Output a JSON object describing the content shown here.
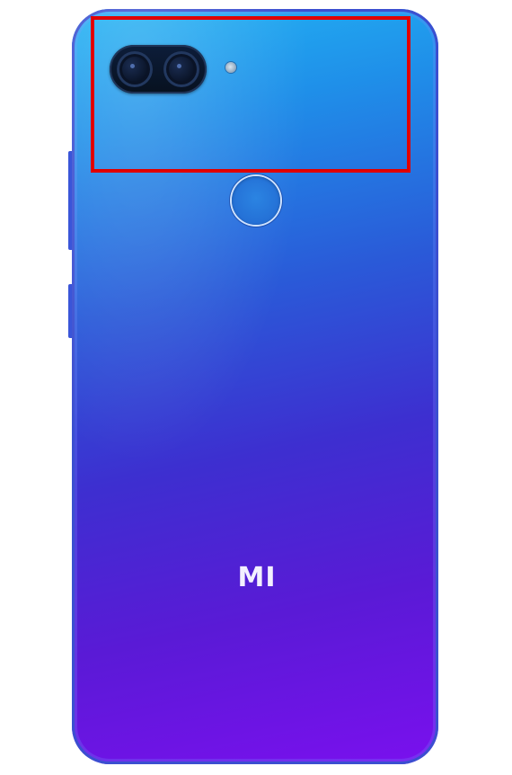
{
  "image": {
    "subject": "smartphone-back",
    "brand_logo_text": "MI",
    "colors": {
      "gradient_top": "#23b4f3",
      "gradient_mid": "#2a5ad8",
      "gradient_bottom": "#7a10ee",
      "frame": "#3b4fd0",
      "highlight": "#e00000",
      "logo": "#f3f0ff"
    }
  }
}
